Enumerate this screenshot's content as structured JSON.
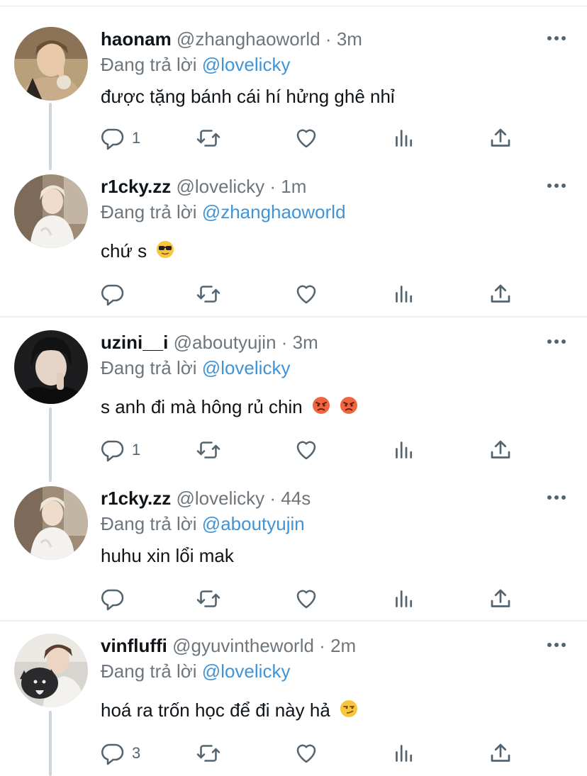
{
  "reply_prefix": "Đang trả lời",
  "tweets": [
    {
      "name": "haonam",
      "handle": "@zhanghaoworld",
      "dot": "·",
      "time": "3m",
      "mention": "@lovelicky",
      "text": "được tặng bánh cái hí hửng ghê nhỉ",
      "reply_count": "1"
    },
    {
      "name": "r1cky.zz",
      "handle": "@lovelicky",
      "dot": "·",
      "time": "1m",
      "mention": "@zhanghaoworld",
      "text": "chứ s",
      "reply_count": ""
    },
    {
      "name": "uzini__i",
      "handle": "@aboutyujin",
      "dot": "·",
      "time": "3m",
      "mention": "@lovelicky",
      "text": "s anh đi mà hông rủ chin",
      "reply_count": "1"
    },
    {
      "name": "r1cky.zz",
      "handle": "@lovelicky",
      "dot": "·",
      "time": "44s",
      "mention": "@aboutyujin",
      "text": "huhu xin lổi mak",
      "reply_count": ""
    },
    {
      "name": "vinfluffi",
      "handle": "@gyuvintheworld",
      "dot": "·",
      "time": "2m",
      "mention": "@lovelicky",
      "text": "hoá ra trốn học để đi này hả",
      "reply_count": "3"
    }
  ],
  "icons": {
    "reply": "reply-icon",
    "retweet": "retweet-icon",
    "like": "heart-icon",
    "views": "analytics-icon",
    "share": "share-icon",
    "more": "more-icon",
    "emoji_sunglasses": "sunglasses-emoji",
    "emoji_angry": "angry-emoji",
    "emoji_smirk": "smirk-emoji"
  },
  "colors": {
    "mention": "#3f94d8",
    "secondary": "#6e767d",
    "icon": "#536471",
    "divider": "#eceff1",
    "thread": "#cfd6db"
  }
}
